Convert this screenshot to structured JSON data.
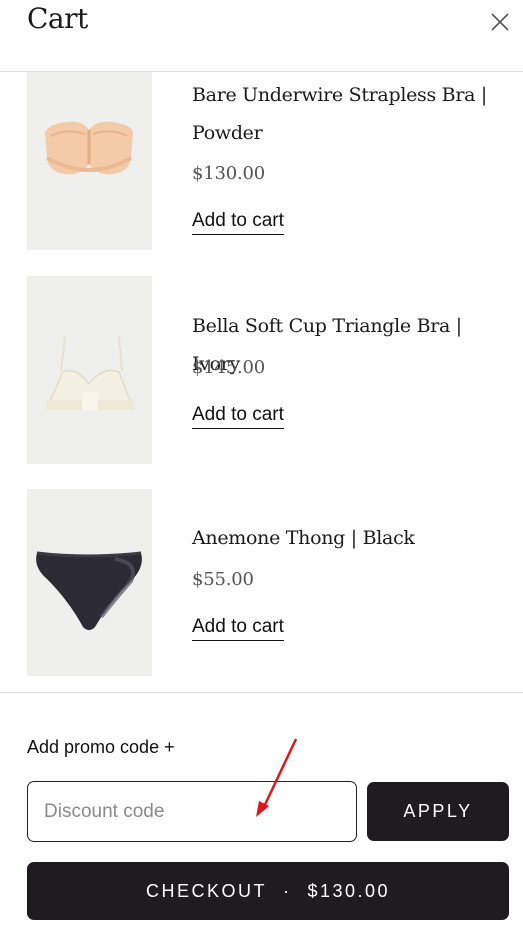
{
  "header": {
    "title": "Cart",
    "close_icon": "close-icon"
  },
  "items": [
    {
      "title": "Bare Underwire Strapless Bra | Powder",
      "price": "$130.00",
      "add_label": "Add to cart"
    },
    {
      "title": "Bella Soft Cup Triangle Bra | Ivory",
      "price": "$145.00",
      "add_label": "Add to cart"
    },
    {
      "title": "Anemone Thong | Black",
      "price": "$55.00",
      "add_label": "Add to cart"
    }
  ],
  "promo": {
    "label": "Add promo code +",
    "placeholder": "Discount code",
    "value": "",
    "apply_label": "APPLY"
  },
  "checkout": {
    "label": "CHECKOUT",
    "separator": "·",
    "total": "$130.00"
  },
  "colors": {
    "button_bg": "#1e1c1e",
    "thumb_bg": "#efefed",
    "annotation_arrow": "#e0161d"
  }
}
